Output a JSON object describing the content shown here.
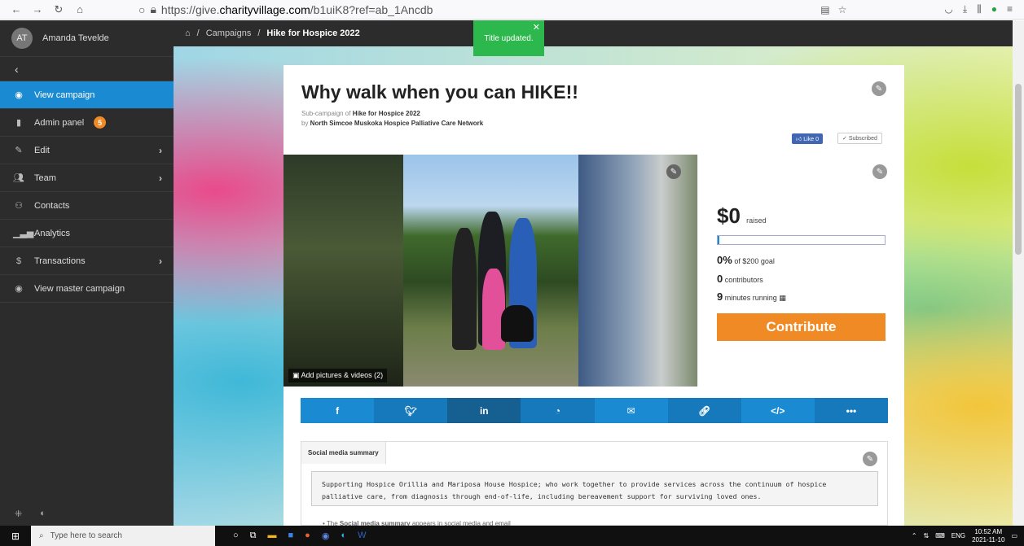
{
  "browser": {
    "url_prefix": "https://give.",
    "url_host": "charityvillage.com",
    "url_path": "/b1uiK8?ref=ab_1Ancdb"
  },
  "sidebar": {
    "user_initials": "AT",
    "user_name": "Amanda Tevelde",
    "items": [
      {
        "label": "View campaign",
        "icon": "eye-icon"
      },
      {
        "label": "Admin panel",
        "icon": "clipboard-icon",
        "badge": "5"
      },
      {
        "label": "Edit",
        "icon": "pencil-icon"
      },
      {
        "label": "Team",
        "icon": "team-icon"
      },
      {
        "label": "Contacts",
        "icon": "contacts-icon"
      },
      {
        "label": "Analytics",
        "icon": "analytics-icon"
      },
      {
        "label": "Transactions",
        "icon": "money-icon"
      },
      {
        "label": "View master campaign",
        "icon": "eye-icon"
      }
    ]
  },
  "breadcrumb": {
    "campaigns": "Campaigns",
    "current": "Hike for Hospice 2022"
  },
  "toast": {
    "message": "Title updated."
  },
  "campaign": {
    "title": "Why walk when you can HIKE!!",
    "sub_prefix": "Sub-campaign of ",
    "sub_parent": "Hike for Hospice 2022",
    "by_prefix": "by ",
    "organization": "North Simcoe Muskoka Hospice Palliative Care Network",
    "like_label": "Like 0",
    "subscribed_label": "Subscribed",
    "add_media_label": "Add pictures & videos (2)"
  },
  "stats": {
    "raised_amount": "$0",
    "raised_label": "raised",
    "progress_fraction": 0,
    "goal_percent": "0%",
    "goal_text": "of $200 goal",
    "contributors_count": "0",
    "contributors_label": "contributors",
    "running_count": "9",
    "running_label": "minutes running",
    "contribute_label": "Contribute"
  },
  "share": {
    "buttons": [
      "facebook-icon",
      "twitter-icon",
      "linkedin-icon",
      "messenger-icon",
      "email-icon",
      "link-icon",
      "embed-icon",
      "more-icon"
    ],
    "linkedin_text": "in",
    "embed_text": "</>",
    "more_text": "•••"
  },
  "social_summary": {
    "tab_label": "Social media summary",
    "text": "Supporting Hospice Orillia and Mariposa House Hospice; who work together to provide services across the continuum of hospice palliative care, from diagnosis through end-of-life, including bereavement support for surviving loved ones.",
    "note_prefix": "The ",
    "note_bold": "Social media summary",
    "note_suffix": " appears in social media and email"
  },
  "taskbar": {
    "search_placeholder": "Type here to search",
    "language": "ENG",
    "time": "10:52 AM",
    "date": "2021-11-10"
  },
  "colors": {
    "accent": "#1a8bd2",
    "contribute": "#f08a24",
    "toast": "#2db84d",
    "sidebar": "#2c2c2c"
  }
}
